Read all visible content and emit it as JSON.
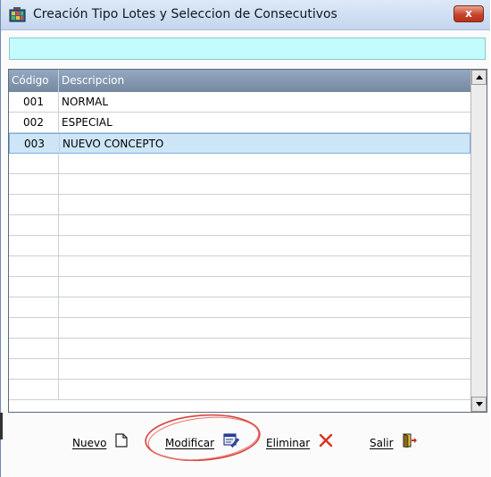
{
  "window": {
    "title": "Creación Tipo Lotes y Seleccion de Consecutivos",
    "icon": "app-grid-icon",
    "close_label": "x"
  },
  "filter": {
    "value": ""
  },
  "table": {
    "columns": [
      "Código",
      "Descripcion"
    ],
    "rows": [
      {
        "code": "001",
        "description": "NORMAL"
      },
      {
        "code": "002",
        "description": "ESPECIAL"
      },
      {
        "code": "003",
        "description": "NUEVO CONCEPTO",
        "selected": true
      }
    ],
    "empty_rows": 12
  },
  "buttons": {
    "nuevo": {
      "label": "Nuevo",
      "icon": "new-document-icon"
    },
    "modificar": {
      "label": "Modificar",
      "icon": "edit-icon"
    },
    "eliminar": {
      "label": "Eliminar",
      "icon": "delete-x-icon"
    },
    "salir": {
      "label": "Salir",
      "icon": "exit-door-icon"
    }
  },
  "colors": {
    "filter_bg": "#c4fbfc",
    "header_bg": "#7f93ab",
    "selected_row": "#cde6f7",
    "annotation": "#d9433a"
  }
}
